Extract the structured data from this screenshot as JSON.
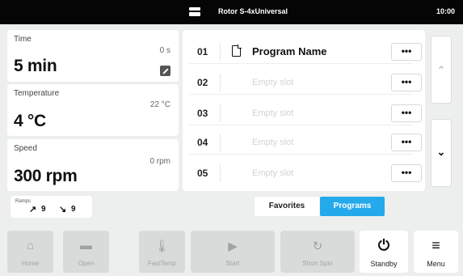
{
  "status": {
    "title": "Rotor S-4xUniversal",
    "clock": "10:00"
  },
  "params": {
    "time": {
      "label": "Time",
      "set": "5 min",
      "actual": "0 s"
    },
    "temperature": {
      "label": "Temperature",
      "set": "4 °C",
      "actual": "22 °C"
    },
    "speed": {
      "label": "Speed",
      "set": "300 rpm",
      "actual": "0 rpm"
    },
    "ramps": {
      "label": "Ramps",
      "up": "9",
      "down": "9"
    }
  },
  "programs": [
    {
      "num": "01",
      "name": "Program Name",
      "more": "•••"
    },
    {
      "num": "02",
      "name": "Empty slot",
      "more": "•••"
    },
    {
      "num": "03",
      "name": "Empty slot",
      "more": "•••"
    },
    {
      "num": "04",
      "name": "Empty slot",
      "more": "•••"
    },
    {
      "num": "05",
      "name": "Empty slot",
      "more": "•••"
    }
  ],
  "tabs": {
    "favorites": "Favorites",
    "programs": "Programs"
  },
  "buttons": {
    "home": "Home",
    "open": "Open",
    "fasttemp": "FastTemp",
    "start": "Start",
    "short_spin": "Short Spin",
    "standby": "Standby",
    "menu": "Menu"
  },
  "colors": {
    "accent": "#24a9ea",
    "status_bar": "#050505",
    "background": "#ecefee"
  }
}
